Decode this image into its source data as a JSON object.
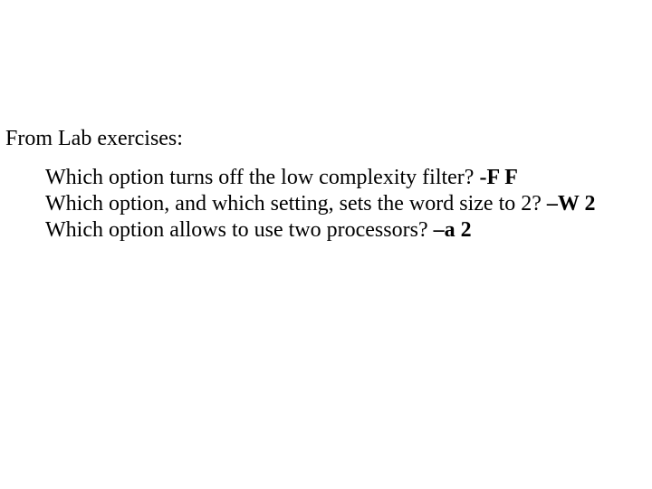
{
  "heading": "From Lab exercises:",
  "lines": {
    "q1_text": "Which option turns off the low complexity filter?  ",
    "q1_ans": "-F F",
    "q2_text": "Which option, and which setting, sets the word size to 2? ",
    "q2_ans": "–W 2",
    "q3_text": "Which option allows to use two processors? ",
    "q3_ans": "–a 2"
  }
}
